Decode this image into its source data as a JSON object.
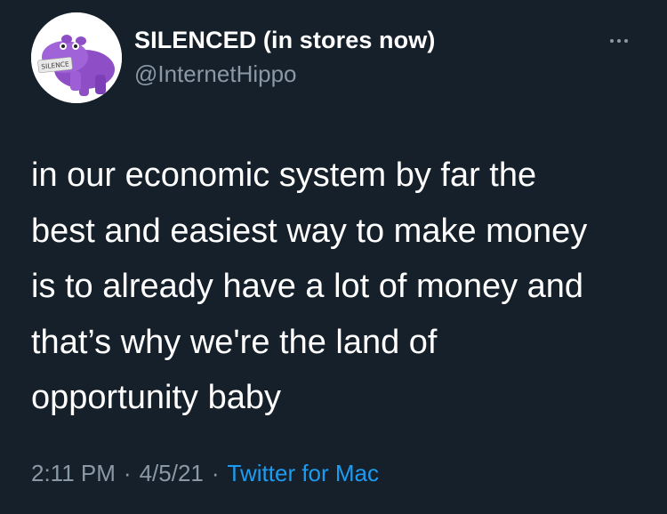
{
  "tweet": {
    "display_name": "SILENCED (in stores now)",
    "handle": "@InternetHippo",
    "avatar_label": "SILENCE",
    "avatar_icon": "purple-hippo-avatar-icon",
    "more_icon": "more-options-icon",
    "body_lines": [
      "in our economic system by far the",
      "best and easiest way to make money",
      "is to already have a lot of money and",
      "that’s why we're the land of",
      "opportunity baby"
    ],
    "time": "2:11 PM",
    "separator": "·",
    "date": "4/5/21",
    "source": "Twitter for Mac"
  },
  "colors": {
    "background": "#15202b",
    "text": "#ffffff",
    "secondary": "#8b98a5",
    "link": "#1d9bf0",
    "avatar_hippo": "#9b59d0"
  }
}
